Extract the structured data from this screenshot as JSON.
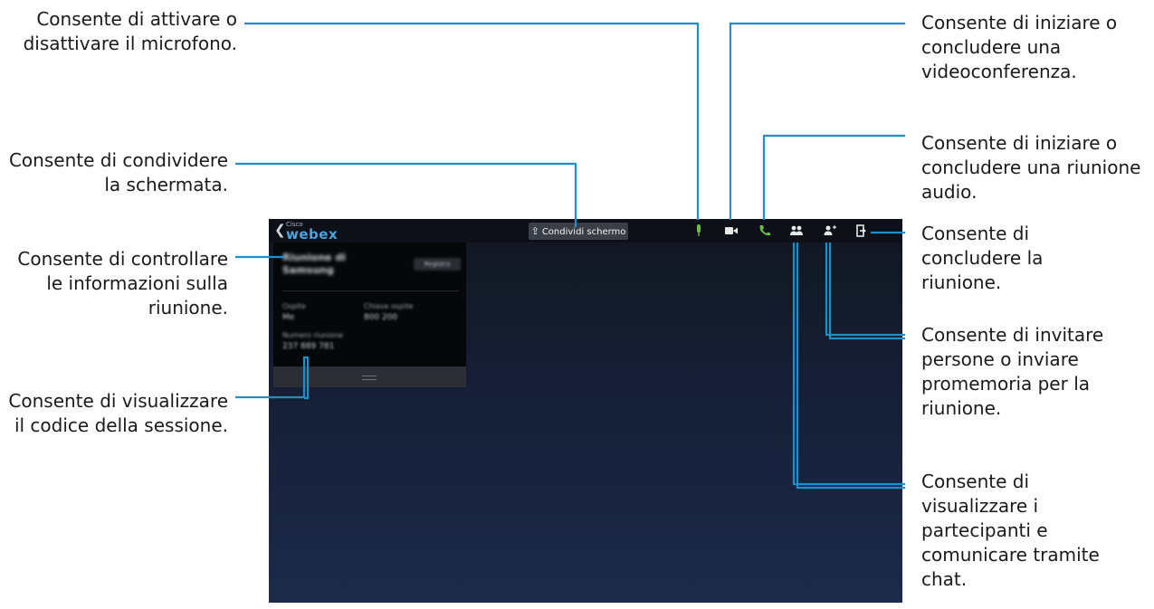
{
  "callouts": {
    "mic": "Consente di attivare o disattivare il microfono.",
    "share": "Consente di condividere la schermata.",
    "meeting_info": "Consente di controllare le informazioni sulla riunione.",
    "session_code": "Consente di visualizzare il codice della sessione.",
    "video": "Consente di iniziare o concludere una videoconferenza.",
    "audio": "Consente di iniziare o concludere una riunione audio.",
    "end_meeting": "Consente di concludere la riunione.",
    "invite": "Consente di invitare persone o inviare promemoria per la riunione.",
    "participants": "Consente di visualizzare i partecipanti e comunicare tramite chat."
  },
  "app": {
    "back_icon": "chevron-left-icon",
    "logo_small": "Cisco",
    "logo": "webex",
    "share_button": "Condividi schermo",
    "share_icon": "upload-icon",
    "toolbar_icons": [
      "microphone-icon",
      "video-camera-icon",
      "phone-icon",
      "participants-icon",
      "add-person-icon",
      "exit-icon"
    ]
  },
  "panel": {
    "title": "Riunione di Samsung",
    "badge": "Registra",
    "host_label": "Ospite",
    "host_value": "Me",
    "password_label": "Chiave ospite",
    "password_value": "800 200",
    "session_label": "Numero riunione",
    "session_value": "237 889 781"
  },
  "colors": {
    "accent_line": "#1e8fc8",
    "screen_bg": "#162038",
    "green_icon": "#6cc04a"
  }
}
